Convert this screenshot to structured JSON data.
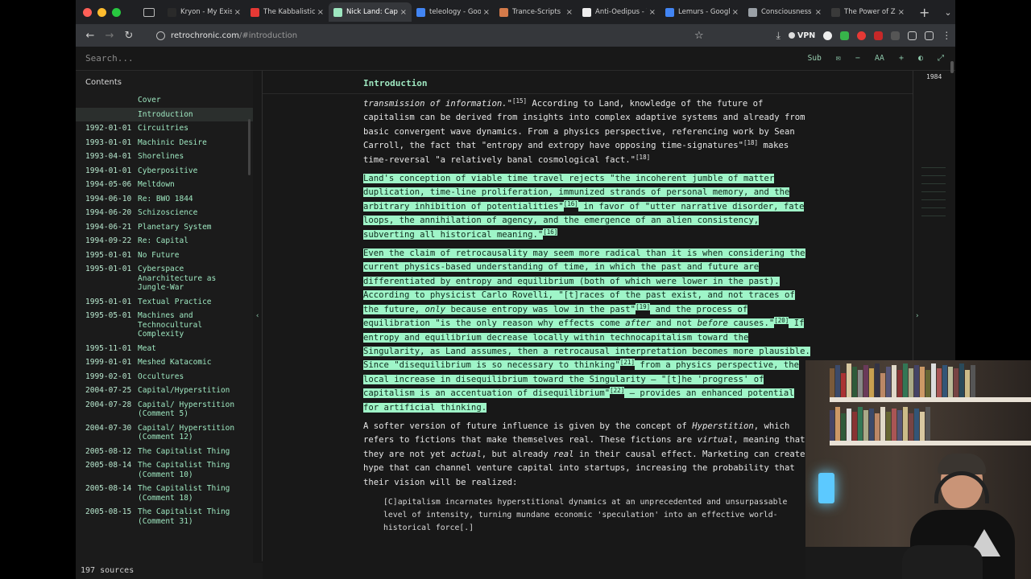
{
  "browser": {
    "tabs": [
      {
        "title": "Kryon - My Existi",
        "color": "#2a2a2a",
        "active": false
      },
      {
        "title": "The Kabbalistic Vi",
        "color": "#e53935",
        "active": false
      },
      {
        "title": "Nick Land: Capit",
        "color": "#9ee7c0",
        "active": true
      },
      {
        "title": "teleology - Goog",
        "color": "#4285f4",
        "active": false
      },
      {
        "title": "Trance-Scripts",
        "color": "#d47a4a",
        "active": false
      },
      {
        "title": "Anti-Oedipus - W",
        "color": "#eeeeee",
        "active": false
      },
      {
        "title": "Lemurs - Google",
        "color": "#4285f4",
        "active": false
      },
      {
        "title": "Consciousness N",
        "color": "#9aa0a6",
        "active": false
      },
      {
        "title": "The Power of Zero -",
        "color": "#3a3a3a",
        "active": false
      }
    ],
    "url_host": "retrochronic.com",
    "url_path": "/#introduction",
    "vpn_label": "VPN"
  },
  "page": {
    "search_placeholder": "Search...",
    "toolbar_sub": "Sub",
    "toolbar_font": "AA",
    "contents_heading": "Contents",
    "doc_title": "Introduction",
    "minimap_year": "1984",
    "footer": "197 sources",
    "toc": [
      {
        "date": "",
        "title": "Cover",
        "active": false
      },
      {
        "date": "",
        "title": "Introduction",
        "active": true
      },
      {
        "date": "1992-01-01",
        "title": "Circuitries",
        "active": false
      },
      {
        "date": "1993-01-01",
        "title": "Machinic Desire",
        "active": false
      },
      {
        "date": "1993-04-01",
        "title": "Shorelines",
        "active": false
      },
      {
        "date": "1994-01-01",
        "title": "Cyberpositive",
        "active": false
      },
      {
        "date": "1994-05-06",
        "title": "Meltdown",
        "active": false
      },
      {
        "date": "1994-06-10",
        "title": "Re: BWO 1844",
        "active": false
      },
      {
        "date": "1994-06-20",
        "title": "Schizoscience",
        "active": false
      },
      {
        "date": "1994-06-21",
        "title": "Planetary System",
        "active": false
      },
      {
        "date": "1994-09-22",
        "title": "Re: Capital",
        "active": false
      },
      {
        "date": "1995-01-01",
        "title": "No Future",
        "active": false
      },
      {
        "date": "1995-01-01",
        "title": "Cyberspace Anarchitecture as Jungle-War",
        "active": false
      },
      {
        "date": "1995-01-01",
        "title": "Textual Practice",
        "active": false
      },
      {
        "date": "1995-05-01",
        "title": "Machines and Technocultural Complexity",
        "active": false
      },
      {
        "date": "1995-11-01",
        "title": "Meat",
        "active": false
      },
      {
        "date": "1999-01-01",
        "title": "Meshed Katacomic",
        "active": false
      },
      {
        "date": "1999-02-01",
        "title": "Occultures",
        "active": false
      },
      {
        "date": "2004-07-25",
        "title": "Capital/Hyperstition",
        "active": false
      },
      {
        "date": "2004-07-28",
        "title": "Capital/ Hyperstition (Comment 5)",
        "active": false
      },
      {
        "date": "2004-07-30",
        "title": "Capital/ Hyperstition (Comment 12)",
        "active": false
      },
      {
        "date": "2005-08-12",
        "title": "The Capitalist Thing",
        "active": false
      },
      {
        "date": "2005-08-14",
        "title": "The Capitalist Thing (Comment 10)",
        "active": false
      },
      {
        "date": "2005-08-14",
        "title": "The Capitalist Thing (Comment 18)",
        "active": false
      },
      {
        "date": "2005-08-15",
        "title": "The Capitalist Thing (Comment 31)",
        "active": false
      }
    ]
  },
  "article": {
    "p1": {
      "a": "transmission of information.\"",
      "s1": "[15]",
      "b": " According to Land, knowledge of the future of capitalism can be derived from insights into complex adaptive systems and already from basic convergent wave dynamics. From a physics perspective, referencing work by Sean Carroll, the fact that \"entropy and extropy have opposing time-signatures\"",
      "s2": "[18]",
      "c": " makes time-reversal \"a relatively banal cosmological fact.\"",
      "s3": "[18]"
    },
    "p2": {
      "a": "Land's conception of viable time travel rejects \"the incoherent jumble of matter duplication, time-line proliferation, immunized strands of personal memory, and the arbitrary inhibition of potentialities\"",
      "s1": "[16]",
      "b": " in favor of \"utter narrative disorder, fate loops, the annihilation of agency, and the emergence of an alien consistency, subverting all historical meaning.\"",
      "s2": "[16]"
    },
    "p3": {
      "a": "Even the claim of retrocausality may seem more radical than it is when considering the current physics-based understanding of time, in which the past and future are differentiated by entropy and equilibrium (both of which were lower in the past). According to physicist Carlo Rovelli, \"[t]races of the past exist, and not traces of the future, ",
      "only": "only",
      "b": " because entropy was low in the past\"",
      "s1": "[19]",
      "c": " and the process of equilibration \"is the only reason why effects come ",
      "after": "after",
      "d": " and not ",
      "before": "before",
      "e": " causes.\"",
      "s2": "[20]",
      "f": " If entropy and equilibrium decrease locally within technocapitalism toward the Singularity, as Land assumes, then a retrocausal interpretation becomes more plausible. Since \"disequilibrium is so necessary to thinking\"",
      "s3": "[21]",
      "g": " from a physics perspective, the local increase in disequilibrium toward the Singularity — \"[t]he 'progress' of capitalism is an accentuation of disequilibrium\"",
      "s4": "[22]",
      "h": " — provides an enhanced potential for artificial thinking."
    },
    "p4": {
      "a": "A softer version of future influence is given by the concept of ",
      "hyp": "Hyperstition",
      "b": ", which refers to fictions that make themselves real. These fictions are ",
      "virtual": "virtual",
      "c": ", meaning that they are not yet ",
      "actual": "actual",
      "d": ", but already ",
      "real": "real",
      "e": " in their causal effect. Marketing can create hype that can channel venture capital into startups, increasing the probability that their vision will be realized:"
    },
    "quote": "[C]apitalism incarnates hyperstitional dynamics at an unprecedented and unsurpassable level of intensity, turning mundane economic 'speculation' into an effective world-historical force[.]"
  },
  "colors": {
    "accent": "#9ee7c0",
    "highlight": "#9ff5c8"
  }
}
